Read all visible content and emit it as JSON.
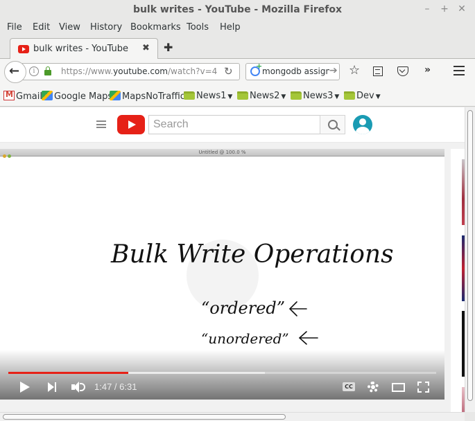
{
  "window": {
    "title": "bulk writes - YouTube - Mozilla Firefox"
  },
  "menu": [
    "File",
    "Edit",
    "View",
    "History",
    "Bookmarks",
    "Tools",
    "Help"
  ],
  "tab": {
    "title": "bulk writes - YouTube"
  },
  "urlbar": {
    "prefix": "https://www.",
    "domain": "youtube.com",
    "path": "/watch?v=4"
  },
  "searchbar": {
    "query": "mongodb assign"
  },
  "bookmarks": [
    "Gmail",
    "Google Maps",
    "MapsNoTraffic",
    "News1",
    "News2",
    "News3",
    "Dev"
  ],
  "youtube": {
    "search_placeholder": "Search",
    "player": {
      "window_title": "Untitled @ 100.0 %",
      "heading": "Bulk Write Operations",
      "item1": "“ordered”",
      "item2": "“unordered”",
      "current_time": "1:47",
      "duration": "6:31",
      "time_display": "1:47 / 6:31",
      "played_fraction": 0.28,
      "loaded_fraction": 0.6,
      "cc_label": "CC"
    }
  },
  "colors": {
    "youtube_red": "#e62117",
    "avatar": "#1a9bb3",
    "lock_green": "#4c9a2a"
  }
}
